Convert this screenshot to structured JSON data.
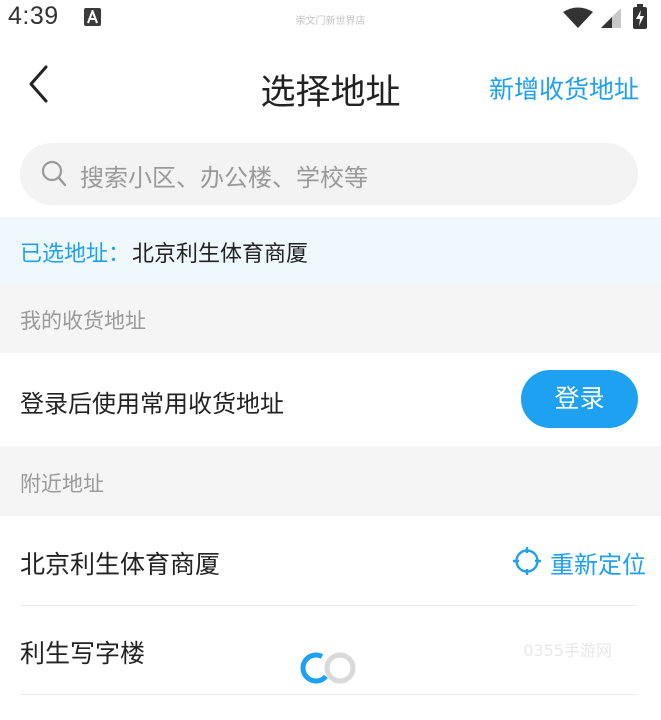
{
  "status_bar": {
    "time": "4:39",
    "carrier_text": "崇文门新世界店",
    "notification_icon": "a-letter-icon",
    "wifi_icon": "wifi-icon",
    "signal_icon": "signal-icon",
    "battery_icon": "battery-charging-icon"
  },
  "nav": {
    "back_icon": "chevron-left-icon",
    "title": "选择地址",
    "add_address": "新增收货地址"
  },
  "search": {
    "placeholder": "搜索小区、办公楼、学校等"
  },
  "selected": {
    "label": "已选地址：",
    "value": "北京利生体育商厦"
  },
  "my_addresses": {
    "header": "我的收货地址",
    "login_prompt": "登录后使用常用收货地址",
    "login_button": "登录"
  },
  "nearby": {
    "header": "附近地址",
    "relocate_label": "重新定位",
    "items": [
      {
        "name": "北京利生体育商厦"
      },
      {
        "name": "利生写字楼"
      }
    ]
  },
  "watermark": "0355手游网",
  "colors": {
    "accent": "#1ea1f0",
    "selected_bg": "#eef8fd",
    "section_bg": "#f5f5f5",
    "text_primary": "#222222",
    "text_secondary": "#9a9a9a"
  }
}
